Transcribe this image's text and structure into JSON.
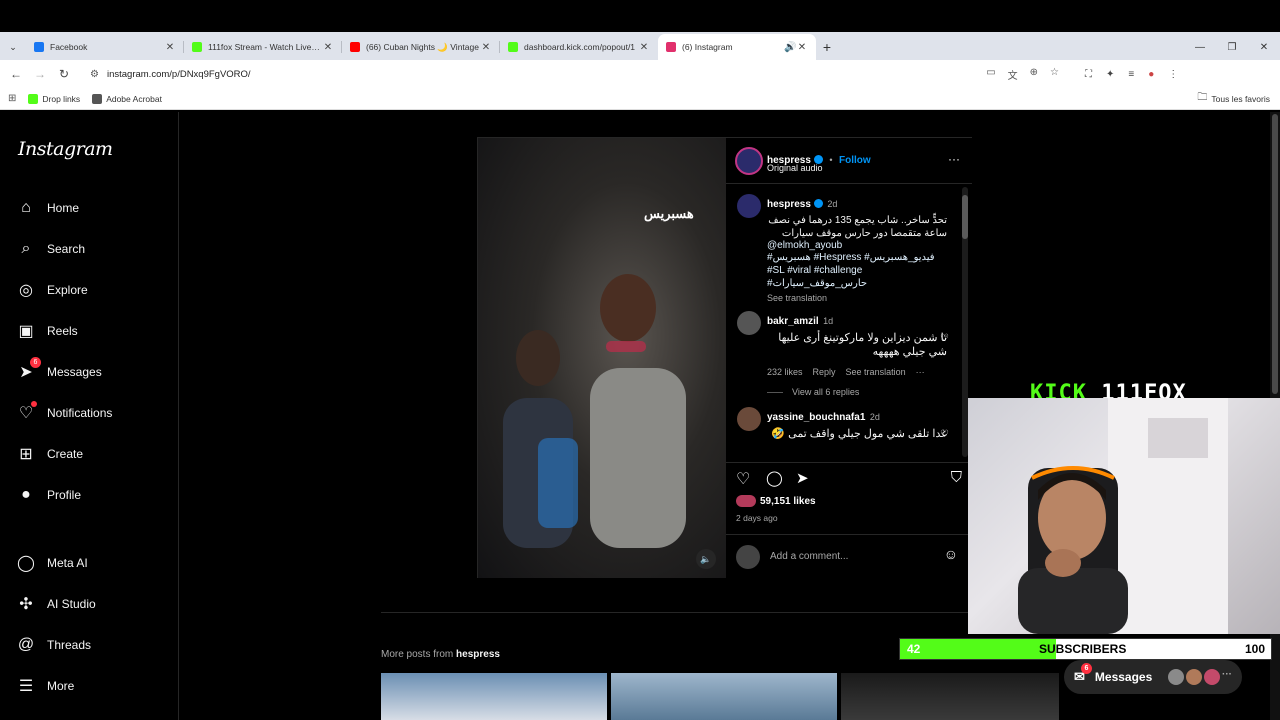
{
  "browser": {
    "tabs": [
      {
        "label": "Facebook",
        "color": "#1877f2"
      },
      {
        "label": "111fox Stream - Watch Live on",
        "color": "#53fc18"
      },
      {
        "label": "(66) Cuban Nights 🌙 Vintage",
        "color": "#ff0000"
      },
      {
        "label": "dashboard.kick.com/popout/1",
        "color": "#53fc18"
      },
      {
        "label": "(6) Instagram",
        "color": "#e1306c"
      }
    ],
    "url": "instagram.com/p/DNxq9FgVORO/",
    "bookmarks": [
      {
        "label": "Drop links",
        "color": "#53fc18"
      },
      {
        "label": "Adobe Acrobat",
        "color": "#555555"
      }
    ],
    "all_bookmarks": "Tous les favoris"
  },
  "instagram": {
    "logo": "Instagram",
    "nav": [
      {
        "label": "Home",
        "icon": "home-icon"
      },
      {
        "label": "Search",
        "icon": "search-icon"
      },
      {
        "label": "Explore",
        "icon": "explore-icon"
      },
      {
        "label": "Reels",
        "icon": "reels-icon"
      },
      {
        "label": "Messages",
        "icon": "messages-icon",
        "badge": "6"
      },
      {
        "label": "Notifications",
        "icon": "heart-icon",
        "dot": true
      },
      {
        "label": "Create",
        "icon": "create-icon"
      },
      {
        "label": "Profile",
        "icon": "profile-icon"
      },
      {
        "label": "Meta AI",
        "icon": "meta-ai-icon"
      },
      {
        "label": "AI Studio",
        "icon": "ai-studio-icon"
      },
      {
        "label": "Threads",
        "icon": "threads-icon"
      },
      {
        "label": "More",
        "icon": "menu-icon"
      }
    ],
    "post": {
      "video_watermark": "هسبريس",
      "author": "hespress",
      "follow": "Follow",
      "audio": "Original audio",
      "caption": {
        "author": "hespress",
        "time": "2d",
        "text": "تحدٍّ ساخر.. شاب يجمع 135 درهما في نصف ساعة متقمصا دور حارس موقف سيارات",
        "mention": "@elmokh_ayoub",
        "tags_line1": "#هسبريس #Hespress #فيديو_هسبريس",
        "tags_line2": "#SL #viral #challenge #حارس_موقف_سيارات",
        "see_translation": "See translation"
      },
      "comments": [
        {
          "user": "bakr_amzil",
          "time": "1d",
          "text": "تا شمن ديزاين ولا ماركوتينغ أرى عليها شي جيلي ههههه",
          "likes": "232 likes",
          "reply": "Reply",
          "see_translation": "See translation",
          "more": "···",
          "replies": "View all 6 replies"
        },
        {
          "user": "yassine_bouchnafa1",
          "time": "2d",
          "text": "غدا تلقى شي مول جيلي واقف تمى 🤣"
        }
      ],
      "likes": "59,151 likes",
      "date": "2 days ago",
      "add_comment": "Add a comment..."
    },
    "more_posts_prefix": "More posts from",
    "more_posts_user": "hespress"
  },
  "overlay": {
    "kick_brand": "KICK",
    "channel": "111FOX",
    "subs_current": "42",
    "subs_label": "SUBSCRIBERS",
    "subs_goal": "100",
    "subs_progress": 0.42,
    "messages_pill": "Messages",
    "messages_badge": "6"
  }
}
